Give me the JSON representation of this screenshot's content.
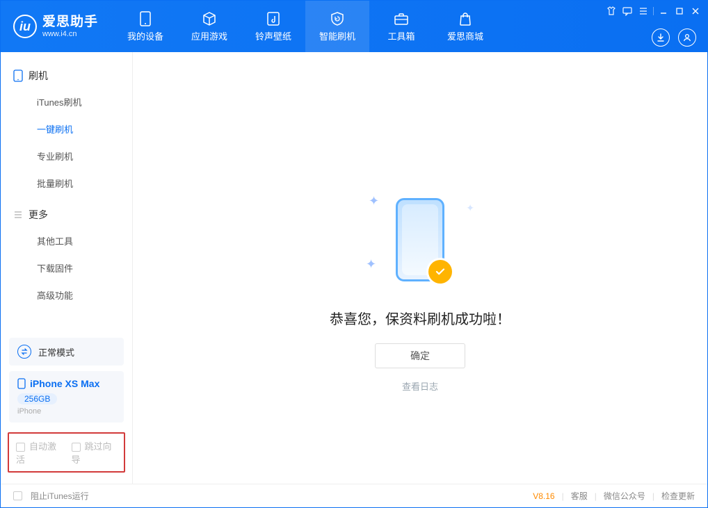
{
  "header": {
    "logo_cn": "爱思助手",
    "logo_en": "www.i4.cn",
    "tabs": [
      {
        "label": "我的设备",
        "icon": "device"
      },
      {
        "label": "应用游戏",
        "icon": "cube"
      },
      {
        "label": "铃声壁纸",
        "icon": "music"
      },
      {
        "label": "智能刷机",
        "icon": "shield"
      },
      {
        "label": "工具箱",
        "icon": "toolbox"
      },
      {
        "label": "爱思商城",
        "icon": "bag"
      }
    ],
    "active_tab_index": 3
  },
  "sidebar": {
    "group1_title": "刷机",
    "group1_items": [
      "iTunes刷机",
      "一键刷机",
      "专业刷机",
      "批量刷机"
    ],
    "group1_active_index": 1,
    "group2_title": "更多",
    "group2_items": [
      "其他工具",
      "下载固件",
      "高级功能"
    ],
    "mode_label": "正常模式",
    "device": {
      "name": "iPhone XS Max",
      "capacity": "256GB",
      "subtype": "iPhone"
    },
    "checkbox_auto_activate": "自动激活",
    "checkbox_skip_guide": "跳过向导"
  },
  "main": {
    "success_text": "恭喜您，保资料刷机成功啦！",
    "confirm_label": "确定",
    "log_link": "查看日志"
  },
  "statusbar": {
    "block_itunes": "阻止iTunes运行",
    "version": "V8.16",
    "link_support": "客服",
    "link_wechat": "微信公众号",
    "link_update": "检查更新"
  }
}
